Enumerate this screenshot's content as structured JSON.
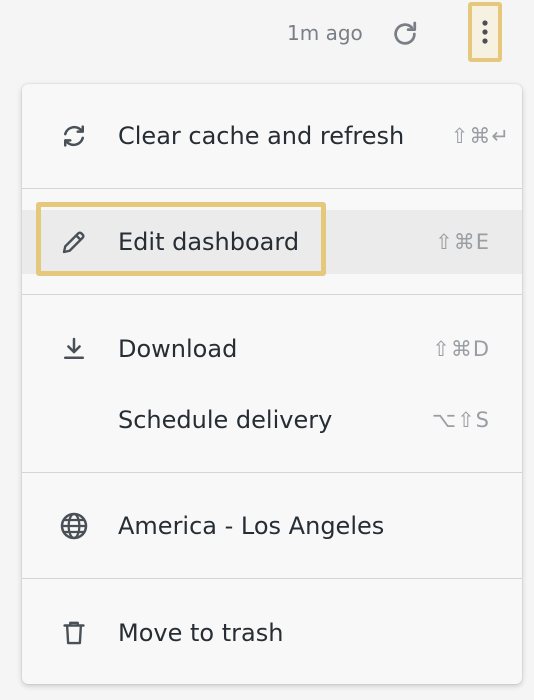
{
  "header": {
    "time_ago": "1m ago",
    "refresh_icon": "refresh-icon",
    "more_icon": "more-vertical-icon"
  },
  "menu": {
    "items": [
      {
        "label": "Clear cache and refresh",
        "shortcut": "⇧⌘↵",
        "icon": "sync-icon"
      },
      {
        "label": "Edit dashboard",
        "shortcut": "⇧⌘E",
        "icon": "pencil-icon",
        "hovered": true
      },
      {
        "label": "Download",
        "shortcut": "⇧⌘D",
        "icon": "download-icon"
      },
      {
        "label": "Schedule delivery",
        "shortcut": "⌥⇧S",
        "icon": ""
      },
      {
        "label": "America - Los Angeles",
        "shortcut": "",
        "icon": "globe-icon"
      },
      {
        "label": "Move to trash",
        "shortcut": "",
        "icon": "trash-icon"
      }
    ]
  },
  "colors": {
    "highlight": "#e6c87c",
    "text": "#262d34",
    "muted": "#7a7f85",
    "icon": "#4a5057"
  }
}
